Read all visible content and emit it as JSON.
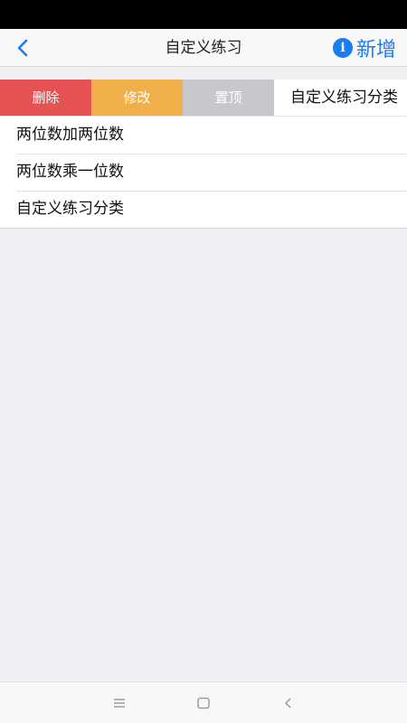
{
  "nav": {
    "title": "自定义练习",
    "add_label": "新增",
    "info_glyph": "i"
  },
  "swipe_row": {
    "actions": {
      "delete": "删除",
      "edit": "修改",
      "pin": "置顶"
    },
    "label": "自定义练习分类"
  },
  "list": {
    "items": [
      "两位数加两位数",
      "两位数乘一位数",
      "自定义练习分类"
    ]
  },
  "colors": {
    "accent": "#1a7cf2",
    "delete": "#e65152",
    "edit": "#f1af4b",
    "pin": "#c8c8cc"
  }
}
